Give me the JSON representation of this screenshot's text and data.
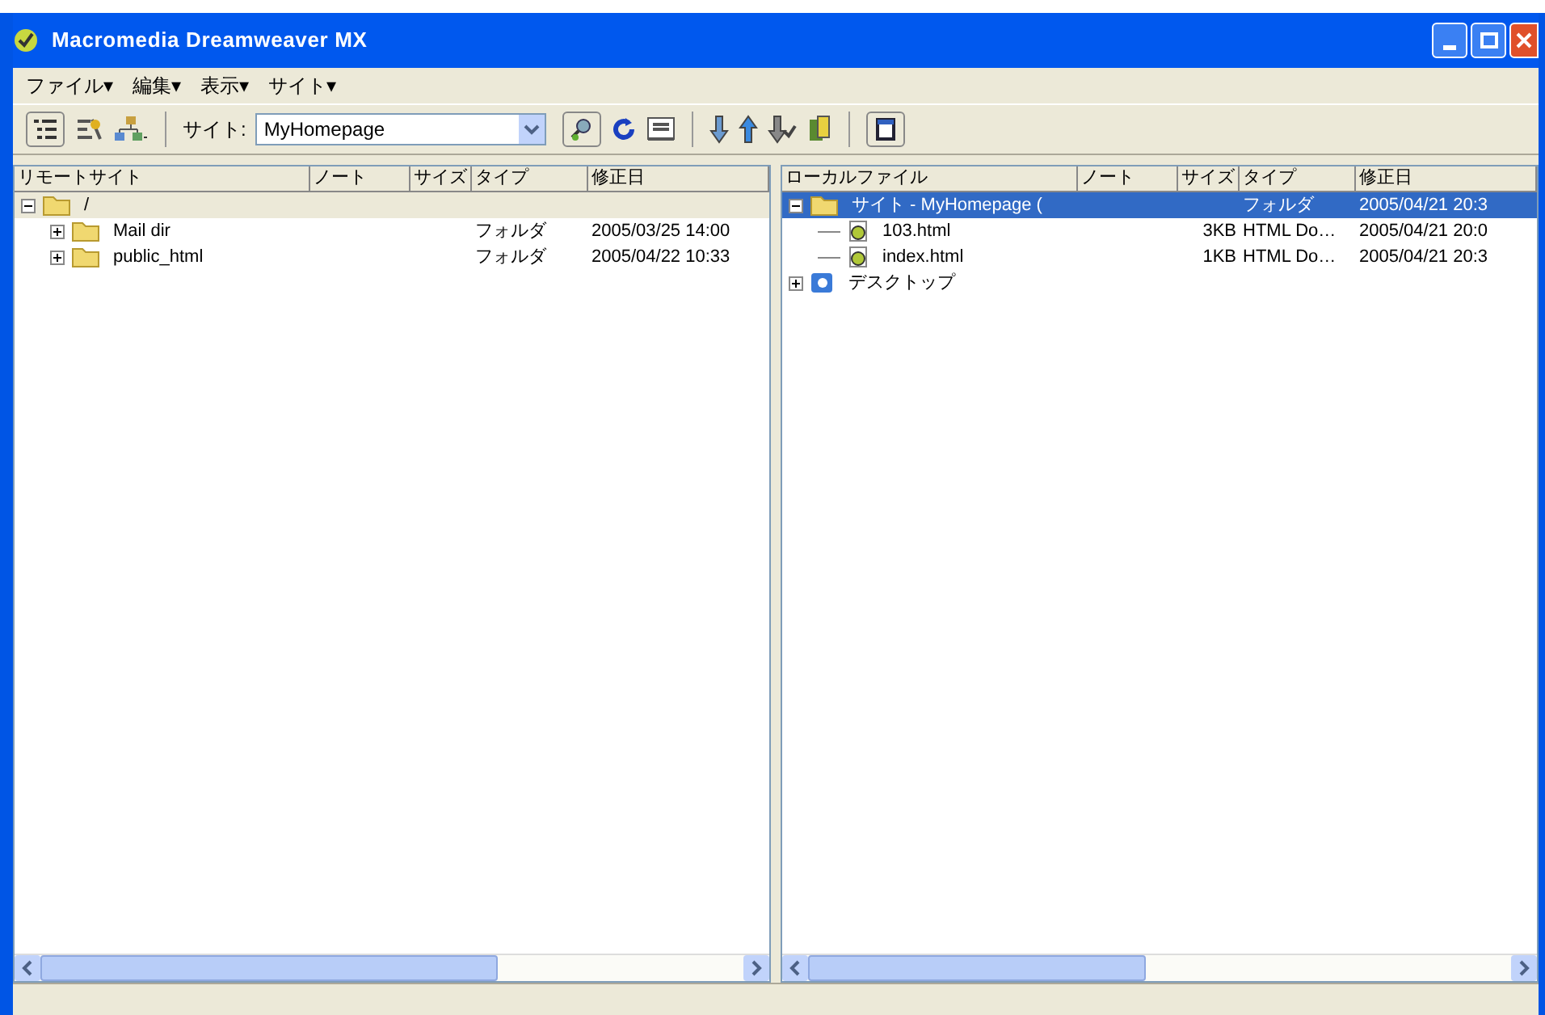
{
  "window": {
    "title": "Macromedia Dreamweaver MX"
  },
  "menu": [
    "ファイル▾",
    "編集▾",
    "表示▾",
    "サイト▾"
  ],
  "toolbar": {
    "site_label": "サイト:",
    "site_value": "MyHomepage"
  },
  "panes": [
    {
      "active": false,
      "columns": [
        "リモートサイト",
        "ノート",
        "サイズ",
        "タイプ",
        "修正日"
      ],
      "tree": [
        {
          "kind": "folder",
          "name": "/",
          "expanded": true,
          "selected": true,
          "children": [
            {
              "kind": "folder",
              "name": "Mail dir",
              "expanded": false,
              "selected": false,
              "type": "フォルダ",
              "date": "2005/03/25 14:00"
            },
            {
              "kind": "folder",
              "name": "public_html",
              "expanded": false,
              "selected": false,
              "type": "フォルダ",
              "date": "2005/04/22 10:33"
            }
          ]
        }
      ]
    },
    {
      "active": true,
      "columns": [
        "ローカルファイル",
        "ノート",
        "サイズ",
        "タイプ",
        "修正日"
      ],
      "tree": [
        {
          "kind": "folder",
          "name": "サイト - MyHomepage (",
          "expanded": true,
          "selected": true,
          "type": "フォルダ",
          "date": "2005/04/21 20:3",
          "children": [
            {
              "kind": "file",
              "name": "103.html",
              "selected": false,
              "size": "3KB",
              "type": "HTML Do…",
              "date": "2005/04/21 20:0"
            },
            {
              "kind": "file",
              "name": "index.html",
              "selected": false,
              "size": "1KB",
              "type": "HTML Do…",
              "date": "2005/04/21 20:3"
            }
          ]
        },
        {
          "kind": "desktop",
          "name": "デスクトップ",
          "expanded": false,
          "selected": false
        }
      ]
    }
  ]
}
